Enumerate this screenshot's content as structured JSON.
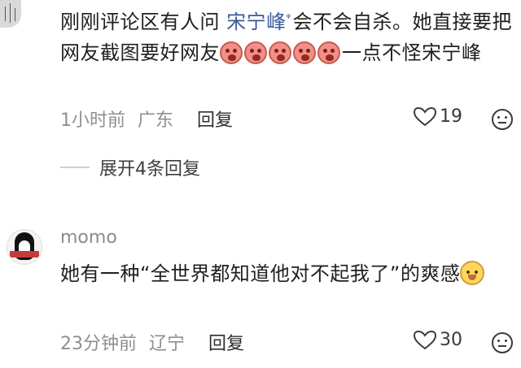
{
  "comments": [
    {
      "text_before": "刚刚评论区有人问",
      "mention": "宋宁峰",
      "text_mid": "会不会自杀。她直接要把网友截图要好网友",
      "text_after": "一点不怪宋宁峰",
      "emoji_count": 5,
      "time": "1小时前",
      "location": "广东",
      "reply": "回复",
      "likes": "19",
      "expand": "展开4条回复"
    },
    {
      "username": "momo",
      "text": "她有一种“全世界都知道他对不起我了”的爽感",
      "time": "23分钟前",
      "location": "辽宁",
      "reply": "回复",
      "likes": "30"
    }
  ],
  "colors": {
    "mention": "#3b5a9a",
    "meta": "#8f8f8f"
  }
}
